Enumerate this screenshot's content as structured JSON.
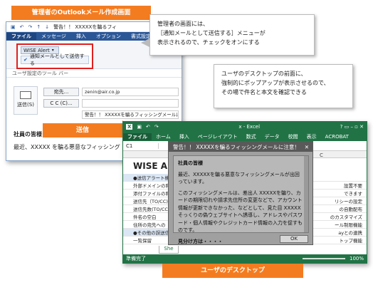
{
  "banners": {
    "admin_screen": "管理者のOutlookメール作成画面",
    "send": "送信",
    "user_desktop": "ユーザのデスクトップ"
  },
  "callouts": {
    "admin_note": "管理者の画面には、\n［通知メールとして送信する］メニューが\n表示されるので、チェックをオンにする",
    "user_note": "ユーザのデスクトップの前面に、\n強制的にポップアップが表示させるので、\nその場で件名と本文を確認できる"
  },
  "outlook": {
    "tabs": [
      "ファイル",
      "メッセージ",
      "挿入",
      "オプション",
      "書式設定"
    ],
    "title_snippet": "警告！！ XXXXXを騙るフィ",
    "wise_alert_button": "WISE Alert",
    "wise_alert_menu_item": "通知メールとして送信する",
    "ribbon_group_label": "ユーザ設定のツール バー",
    "to_button": "宛先...",
    "cc_button": "C C (C)...",
    "send_button": "送信(S)",
    "to_value": "zenin@air.co.jp",
    "subject_value": "警告！！ XXXXXを騙るフィッシングメールに注意！",
    "body_line1": "社員の皆様",
    "body_line2": "最近、XXXXX を騙る悪意なフィッシング"
  },
  "excel": {
    "title_suffix": "x - Excel",
    "tabs": [
      "ファイル",
      "ホーム",
      "挿入",
      "ページレイアウト",
      "数式",
      "データ",
      "校閲",
      "表示",
      "ACROBAT"
    ],
    "name_box": "C1",
    "sheet_title": "WISE Ale",
    "col_c": "C",
    "rows_left": [
      "●送信アラート機",
      "外部ドメインの利",
      "添付ファイルの利",
      "送信先（TO/CC)",
      "送信先数(TO/CC",
      "件名の空白",
      "住所の宛先への",
      "●その他の誤送信",
      "一覧保留"
    ],
    "rows_right": [
      "",
      "設置不要",
      "できます",
      "リシーの設定",
      "の自動配布",
      "のカスタマイズ",
      "ール制限機能",
      "ayとの連携",
      "トップ機能"
    ],
    "sheet_tab": "She",
    "status_left": "準備完了",
    "zoom": "100%",
    "window_controls": "? ▭ – ▫ ✕"
  },
  "popup": {
    "title": "警告！！ XXXXXを騙るフィッシングメールに注意！",
    "greeting": "社員の皆様",
    "para1": "最近、XXXXXを騙る悪意なフィッシングメールが出回っています。",
    "para2": "このフィッシングメールは、差出人 XXXXXを騙り、カードの期限切れや請求先住所の変更などで、アカウント情報が更新できなかった、などとして、見た目 XXXXXそっくりの偽ウェブサイトへ誘導し、アドレスやパスワード・個人情報やクレジットカード情報の入力を促すものです。",
    "para3": "見分け方は・・・・",
    "ok_button": "OK"
  }
}
